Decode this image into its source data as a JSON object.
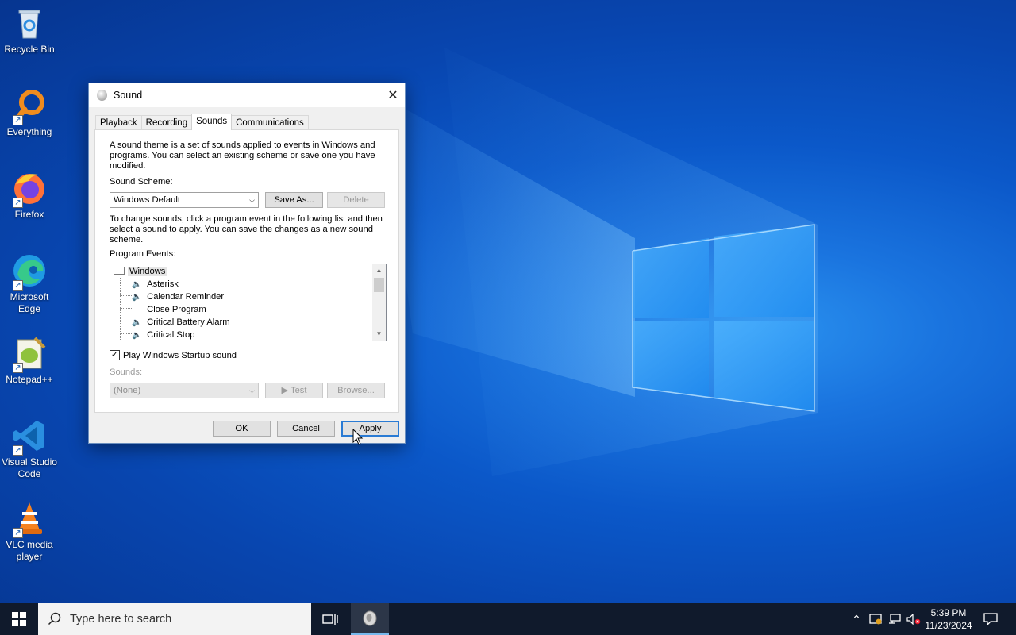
{
  "desktop": {
    "icons": [
      {
        "label": "Recycle Bin",
        "icon": "recycle-bin-icon"
      },
      {
        "label": "Everything",
        "icon": "everything-search-icon"
      },
      {
        "label": "Firefox",
        "icon": "firefox-icon"
      },
      {
        "label": "Microsoft Edge",
        "icon": "edge-icon"
      },
      {
        "label": "Notepad++",
        "icon": "notepadpp-icon"
      },
      {
        "label": "Visual Studio Code",
        "icon": "vscode-icon"
      },
      {
        "label": "VLC media player",
        "icon": "vlc-icon"
      }
    ]
  },
  "dialog": {
    "title": "Sound",
    "tabs": [
      "Playback",
      "Recording",
      "Sounds",
      "Communications"
    ],
    "active_tab": "Sounds",
    "intro": "A sound theme is a set of sounds applied to events in Windows and programs.  You can select an existing scheme or save one you have modified.",
    "scheme_label": "Sound Scheme:",
    "scheme_value": "Windows Default",
    "save_as": "Save As...",
    "delete": "Delete",
    "instructions": "To change sounds, click a program event in the following list and then select a sound to apply.  You can save the changes as a new sound scheme.",
    "events_label": "Program Events:",
    "events_root": "Windows",
    "events": [
      {
        "label": "Asterisk",
        "has_sound": true
      },
      {
        "label": "Calendar Reminder",
        "has_sound": true
      },
      {
        "label": "Close Program",
        "has_sound": false
      },
      {
        "label": "Critical Battery Alarm",
        "has_sound": true
      },
      {
        "label": "Critical Stop",
        "has_sound": true
      }
    ],
    "startup_label": "Play Windows Startup sound",
    "startup_checked": true,
    "sounds_label": "Sounds:",
    "sounds_value": "(None)",
    "test": "Test",
    "browse": "Browse...",
    "ok": "OK",
    "cancel": "Cancel",
    "apply": "Apply"
  },
  "taskbar": {
    "search_placeholder": "Type here to search",
    "time": "5:39 PM",
    "date": "11/23/2024"
  },
  "colors": {
    "desktop_blue": "#0b58c9",
    "taskbar": "#101a2c",
    "accent": "#2a7bd4"
  }
}
